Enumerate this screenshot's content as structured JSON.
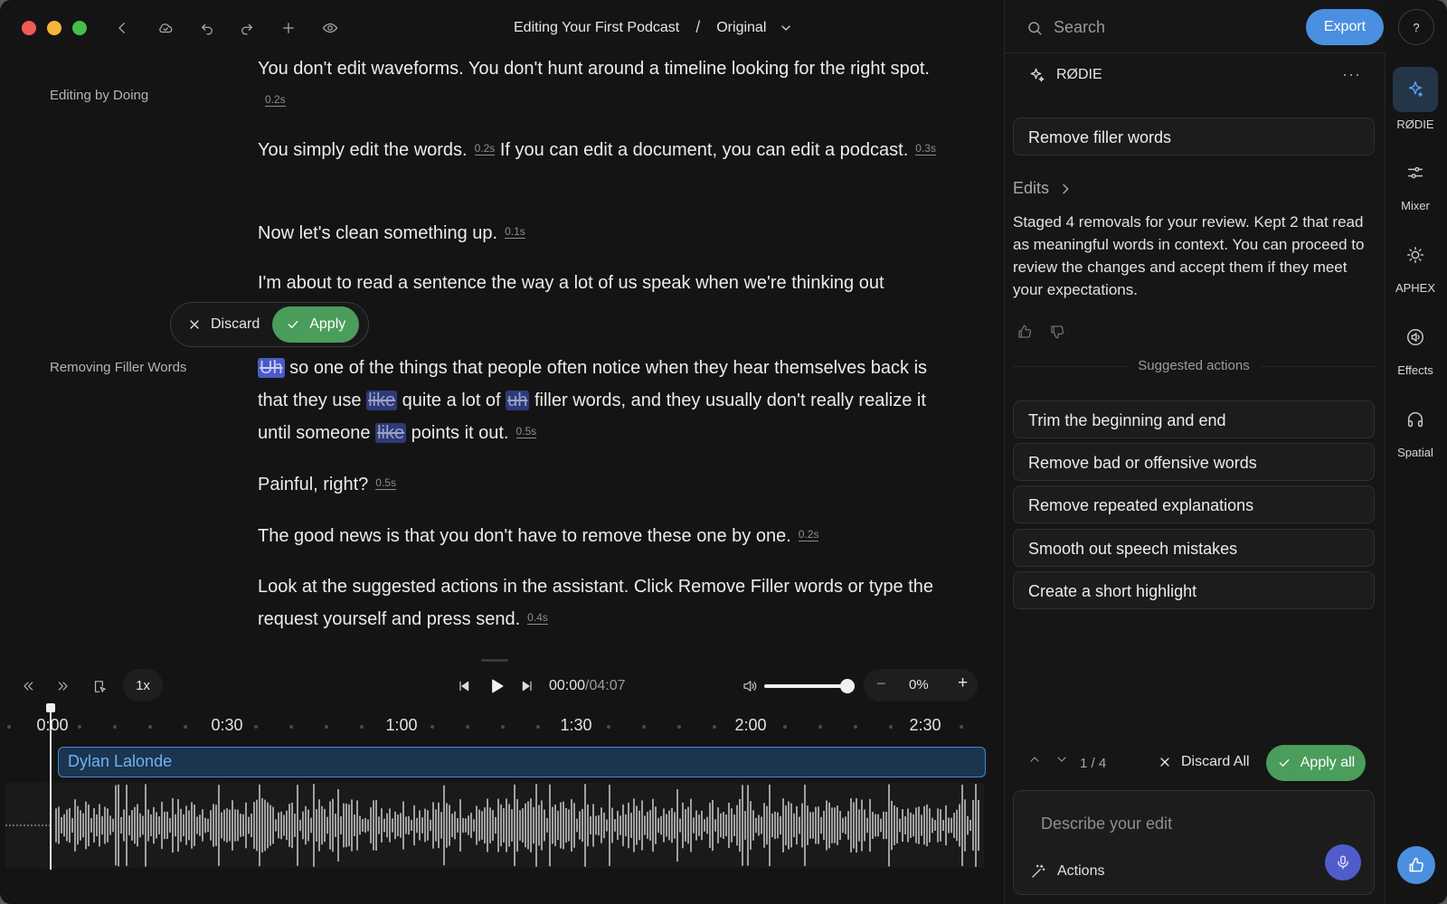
{
  "titlebar": {
    "project_title": "Editing Your First Podcast",
    "separator": "/",
    "version": "Original"
  },
  "transcript": {
    "sections": [
      {
        "label": "Editing by Doing"
      },
      {
        "label": "Removing Filler Words"
      }
    ],
    "p1_text": "You don't edit waveforms. You don't hunt around a timeline looking for the right spot.",
    "p1_gap": "0.2s",
    "p2_a": "You simply edit the words.",
    "p2_gap_a": "0.2s",
    "p2_b": "If you can edit a document, you can edit a podcast.",
    "p2_gap_b": "0.3s",
    "p3_text": "Now let's clean something up.",
    "p3_gap": "0.1s",
    "p4_text": "I'm about to read a sentence the way a lot of us speak when we're thinking out",
    "p5_f1": "Uh",
    "p5_t1": " so one of the things that people often notice when they hear themselves back is that they use ",
    "p5_f2": "like",
    "p5_t2": " quite a lot of ",
    "p5_f3": "uh",
    "p5_t3": " filler words, and they usually don't really realize it until someone ",
    "p5_f4": "like",
    "p5_t4": " points it out.",
    "p5_gap": "0.5s",
    "p6_text": "Painful, right?",
    "p6_gap": "0.5s",
    "p7_text": "The good news is that you don't have to remove these one by one.",
    "p7_gap": "0.2s",
    "p8_text": "Look at the suggested actions in the assistant. Click Remove Filler words or type the request yourself and press send.",
    "p8_gap": "0.4s"
  },
  "inline_edit": {
    "discard_label": "Discard",
    "apply_label": "Apply"
  },
  "playback": {
    "speed": "1x",
    "current_time": "00:00",
    "duration": "/04:07",
    "volume_pct": 1.0,
    "zoom": "0%"
  },
  "timeline": {
    "ticks": [
      "0:00",
      "0:30",
      "1:00",
      "1:30",
      "2:00",
      "2:30"
    ],
    "track_name": "Dylan Lalonde"
  },
  "assistant": {
    "search_placeholder": "Search",
    "export_label": "Export",
    "help_label": "?",
    "name": "RØDIE",
    "more": "···",
    "user_prompt": "Remove filler words",
    "edits_label": "Edits",
    "summary": "Staged 4 removals for your review. Kept 2 that read as meaningful words in context. You can proceed to review the changes and accept them if they meet your expectations.",
    "suggested_label": "Suggested actions",
    "suggested_actions": [
      "Trim the beginning and end",
      "Remove bad or offensive words",
      "Remove repeated explanations",
      "Smooth out speech mistakes",
      "Create a short highlight"
    ],
    "counter": "1 / 4",
    "discard_all": "Discard All",
    "apply_all": "Apply all",
    "composer_placeholder": "Describe your edit",
    "actions_label": "Actions"
  },
  "rail": {
    "items": [
      {
        "label": "RØDIE",
        "icon": "sparkle-icon"
      },
      {
        "label": "Mixer",
        "icon": "sliders-icon"
      },
      {
        "label": "APHEX",
        "icon": "sun-icon"
      },
      {
        "label": "Effects",
        "icon": "speaker-icon"
      },
      {
        "label": "Spatial",
        "icon": "headphones-icon"
      }
    ]
  },
  "colors": {
    "accent_blue": "#4b8fe0",
    "apply_green": "#4a9d5b",
    "filler_highlight": "#2e3a78",
    "track_border": "#3a8ad6"
  }
}
